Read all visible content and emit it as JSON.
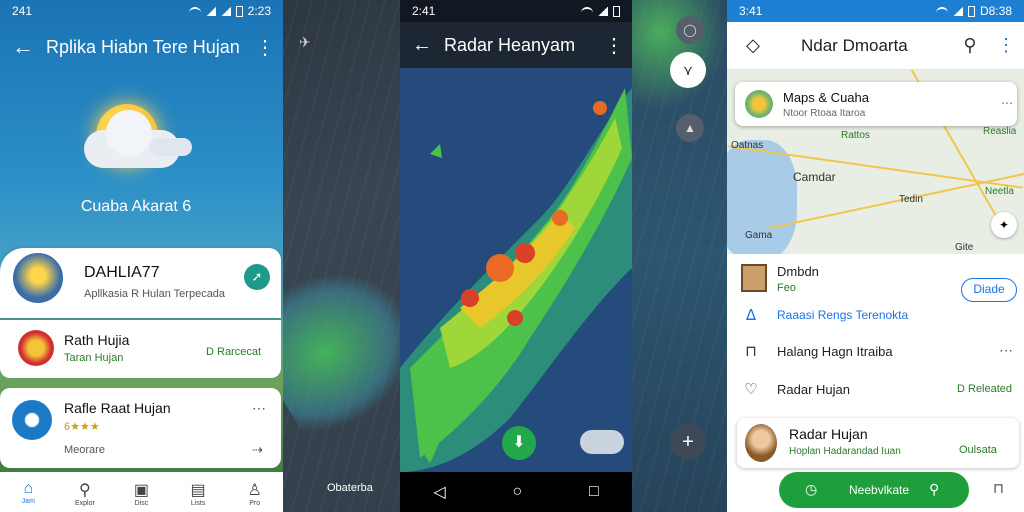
{
  "panel1": {
    "status_time": "241",
    "status_right": "2:23",
    "title": "Rplika Hiabn Tere Hujan",
    "weather_text": "Cuaba Akarat 6",
    "profile": {
      "name": "DAHLIA77",
      "subtitle": "Apllkasia R Hulan Terpecada"
    },
    "apps": [
      {
        "title": "Rath Hujia",
        "subtitle": "Taran Hujan",
        "badge": "D Rarcecat"
      },
      {
        "title": "Rafle Raat Hujan",
        "subtitle": "6★★★",
        "extra": "Meorare"
      }
    ],
    "nav": [
      "Jam",
      "Explor",
      "Disc",
      "Lists",
      "Pro"
    ]
  },
  "panel2": {
    "label": "Obaterba"
  },
  "panel3": {
    "status_time": "2:41",
    "title": "Radar Heanyam"
  },
  "panel5": {
    "status_time": "3:41",
    "status_right": "D8:38",
    "title": "Ndar Dmoarta",
    "map_card": {
      "title": "Maps & Cuaha",
      "subtitle": "Ntoor Rtoaa  Itaroa"
    },
    "map_labels": [
      "Oatnas",
      "Rattos",
      "Reaslia",
      "Camdar",
      "Tedin",
      "Gama",
      "Gite",
      "Neetla"
    ],
    "contact": {
      "name": "Dmbdn",
      "sub": "Feo",
      "button": "Diade"
    },
    "rows": [
      {
        "text": "Raaasi Rengs Terenokta"
      },
      {
        "text": "Halang Hagn Itraiba"
      },
      {
        "text": "Radar Hujan",
        "badge": "D Releated"
      }
    ],
    "bottom_card": {
      "title": "Radar Hujan",
      "subtitle": "Hoplan Hadarandad Iuan",
      "badge": "Oulsata"
    },
    "bottom_button": "Neebvlkate"
  }
}
